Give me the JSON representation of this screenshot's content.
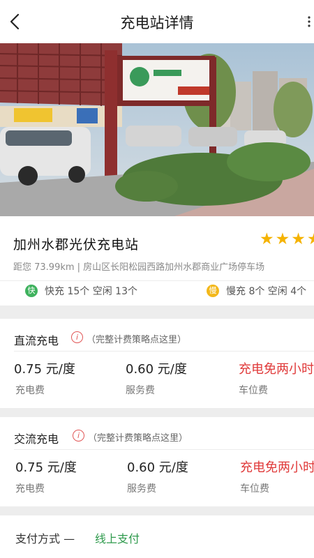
{
  "header": {
    "title": "充电站详情",
    "back_icon": "back-arrow-icon",
    "more_icon": "more-vertical-icon"
  },
  "gallery": {
    "dots": 3,
    "active_index": 0
  },
  "station": {
    "name": "加州水郡光伏充电站",
    "rating": 4,
    "address": "距您 73.99km | 房山区长阳松园西路加州水郡商业广场停车场",
    "fast_badge": "快",
    "fast_text": "快充 15个 空闲 13个",
    "slow_badge": "慢",
    "slow_text": "慢充 8个 空闲 4个"
  },
  "dc": {
    "title": "直流充电",
    "link": "（完整计费策略点这里）",
    "charge_value": "0.75 元/度",
    "charge_label": "充电费",
    "service_value": "0.60 元/度",
    "service_label": "服务费",
    "parking_value": "充电免两小时",
    "parking_label": "车位费"
  },
  "ac": {
    "title": "交流充电",
    "link": "（完整计费策略点这里）",
    "charge_value": "0.75 元/度",
    "charge_label": "充电费",
    "service_value": "0.60 元/度",
    "service_label": "服务费",
    "parking_value": "充电免两小时",
    "parking_label": "车位费"
  },
  "payment": {
    "label": "支付方式 —",
    "value": "线上支付"
  },
  "colors": {
    "accent_green": "#2e9a4c",
    "price_red": "#e03a3a",
    "star": "#f5b300",
    "fast": "#3fb25e",
    "slow": "#f3b81b"
  }
}
